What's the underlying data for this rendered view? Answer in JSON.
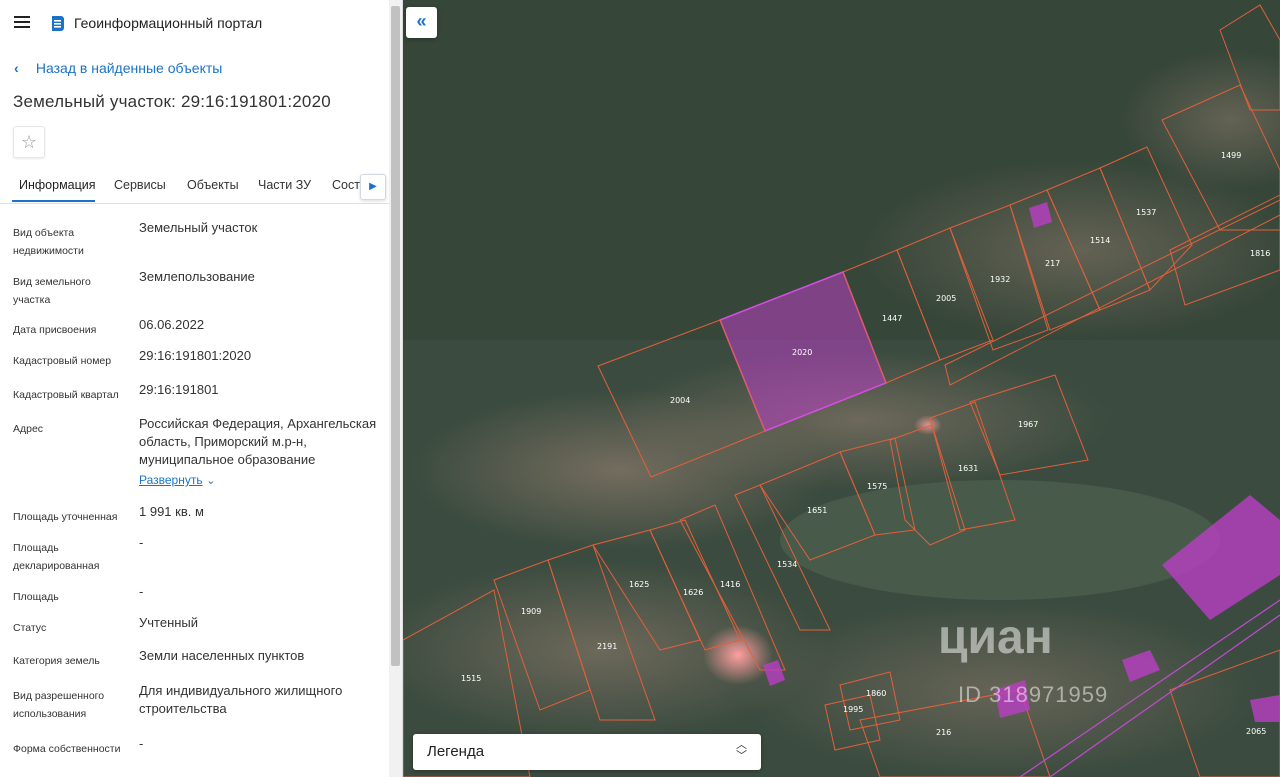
{
  "header": {
    "app_title": "Геоинформационный портал"
  },
  "back_link": "Назад в найденные объекты",
  "page_title": "Земельный участок: 29:16:191801:2020",
  "tabs": [
    {
      "label": "Информация",
      "active": true
    },
    {
      "label": "Сервисы"
    },
    {
      "label": "Объекты"
    },
    {
      "label": "Части ЗУ"
    },
    {
      "label": "Соста"
    }
  ],
  "fields": [
    {
      "label": "Вид объекта недвижимости",
      "value": "Земельный участок"
    },
    {
      "label": "Вид земельного участка",
      "value": "Землепользование"
    },
    {
      "label": "Дата присвоения",
      "value": "06.06.2022"
    },
    {
      "label": "Кадастровый номер",
      "value": "29:16:191801:2020"
    },
    {
      "label": "Кадастровый квартал",
      "value": "29:16:191801"
    },
    {
      "label": "Адрес",
      "value": "Российская Федерация, Архангельская область, Приморский м.р-н, муниципальное образование"
    },
    {
      "label": "Площадь уточненная",
      "value": "1 991 кв. м"
    },
    {
      "label": "Площадь декларированная",
      "value": "-"
    },
    {
      "label": "Площадь",
      "value": "-"
    },
    {
      "label": "Статус",
      "value": "Учтенный"
    },
    {
      "label": "Категория земель",
      "value": "Земли населенных пунктов"
    },
    {
      "label": "Вид разрешенного использования",
      "value": "Для индивидуального жилищного строительства"
    },
    {
      "label": "Форма собственности",
      "value": "-"
    }
  ],
  "expand_label": "Развернуть",
  "legend_label": "Легенда",
  "watermark": {
    "brand": "циан",
    "id": "ID 318971959"
  },
  "map_parcels": [
    "2020",
    "2004",
    "1447",
    "2005",
    "1932",
    "217",
    "1514",
    "1537",
    "1499",
    "1816",
    "1967",
    "1631",
    "1575",
    "1651",
    "1534",
    "1416",
    "1626",
    "1625",
    "2191",
    "1909",
    "1515",
    "1860",
    "1995",
    "216",
    "2065"
  ],
  "colors": {
    "accent": "#1a73c8",
    "parcel_border": "#e2603a",
    "selected_fill": "#b93fc4",
    "map_bg": "#3d4d40"
  },
  "icons": {
    "menu": "hamburger-icon",
    "logo": "logo-icon",
    "back": "chevron-left-icon",
    "favorite": "star-icon",
    "tab_scroll": "chevron-right-icon",
    "collapse": "double-chevron-left-icon",
    "legend": "up-down-chevron-icon"
  }
}
